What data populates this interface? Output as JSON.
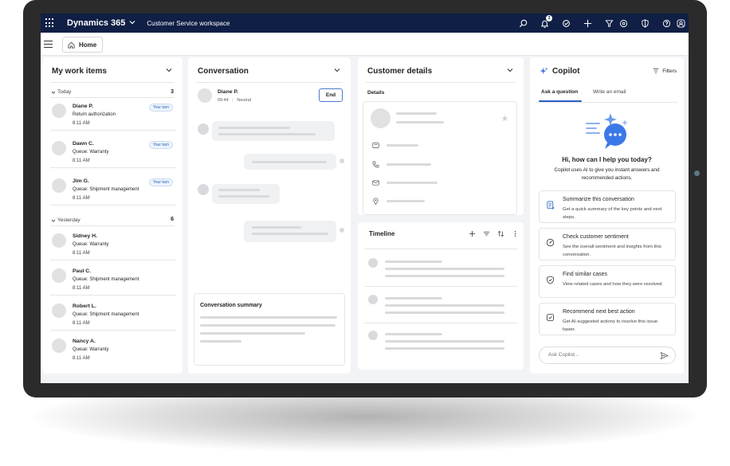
{
  "topbar": {
    "app_name": "Dynamics 365",
    "workspace": "Customer Service workspace",
    "notification_count": "3"
  },
  "subbar": {
    "home_tab": "Home"
  },
  "work_items": {
    "title": "My work items",
    "sections": [
      {
        "label": "Today",
        "count": "3",
        "items": [
          {
            "name": "Diane P.",
            "detail": "Return authorization",
            "time": "8:11 AM",
            "badge": "Your turn"
          },
          {
            "name": "Dawn C.",
            "detail": "Queue: Warranty",
            "time": "8:11 AM",
            "badge": "Your turn"
          },
          {
            "name": "Jim G.",
            "detail": "Queue: Shipment management",
            "time": "8:11 AM",
            "badge": "Your turn"
          }
        ]
      },
      {
        "label": "Yesterday",
        "count": "6",
        "items": [
          {
            "name": "Sidney H.",
            "detail": "Queue: Warranty",
            "time": "8:11 AM"
          },
          {
            "name": "Paul C.",
            "detail": "Queue: Shipment management",
            "time": "8:11 AM"
          },
          {
            "name": "Robert L.",
            "detail": "Queue: Shipment management",
            "time": "8:11 AM"
          },
          {
            "name": "Nancy A.",
            "detail": "Queue: Warranty",
            "time": "8:11 AM"
          }
        ]
      }
    ]
  },
  "conversation": {
    "title": "Conversation",
    "contact_name": "Diane P.",
    "contact_time": "09:44",
    "contact_sentiment": "Neutral",
    "end_label": "End",
    "summary_title": "Conversation summary"
  },
  "customer": {
    "title": "Customer details",
    "details_label": "Details",
    "timeline_title": "Timeline"
  },
  "copilot": {
    "title": "Copilot",
    "filters_label": "Filters",
    "tabs": [
      "Ask a question",
      "Write an email"
    ],
    "greeting": "Hi, how can I help you today?",
    "description": "Copilot uses AI to give you instant answers and recommended actions.",
    "suggestions": [
      {
        "title": "Summarize this conversation",
        "desc": "Get a quick summary of the key points and next steps."
      },
      {
        "title": "Check customer sentiment",
        "desc": "See the overall sentiment and insights from this conversation."
      },
      {
        "title": "Find similar cases",
        "desc": "View related cases and how they were resolved."
      },
      {
        "title": "Recommend next best action",
        "desc": "Get AI-suggested actions to resolve this issue faster."
      }
    ],
    "input_placeholder": "Ask Copilot..."
  },
  "colors": {
    "topbar": "#0f1f45",
    "accent": "#2b5fc0",
    "background": "#f2f3f6"
  }
}
